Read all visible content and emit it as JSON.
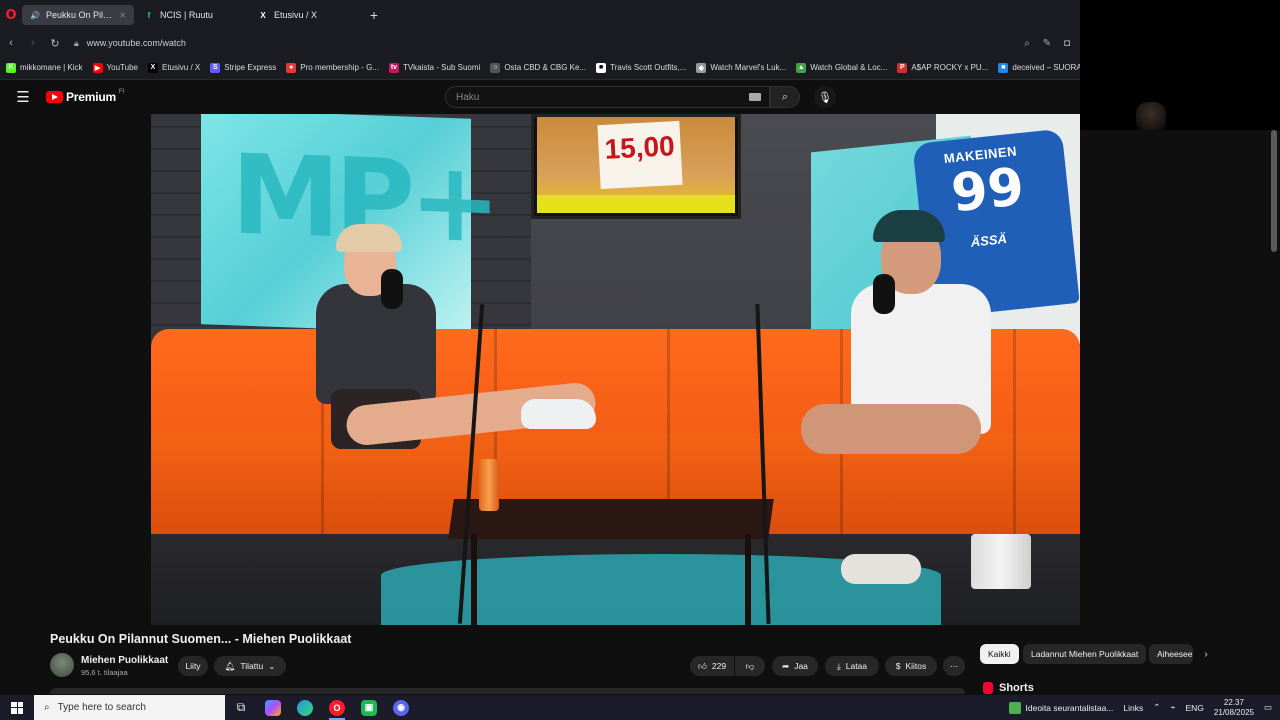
{
  "browser": {
    "tabs": [
      {
        "title": "Peukku On Pilannut S",
        "icon": "speaker-icon",
        "active": true
      },
      {
        "title": "NCIS | Ruutu",
        "icon": "ruutu-icon",
        "active": false
      },
      {
        "title": "Etusivu / X",
        "icon": "x-icon",
        "active": false
      }
    ],
    "url": "www.youtube.com/watch",
    "bookmarks": [
      {
        "label": "mikkomane | Kick",
        "icon_color": "#53fc18",
        "glyph": "K"
      },
      {
        "label": "YouTube",
        "icon_color": "#ff0000",
        "glyph": "▶"
      },
      {
        "label": "Etusivu / X",
        "icon_color": "#000000",
        "glyph": "X"
      },
      {
        "label": "Stripe Express",
        "icon_color": "#635bff",
        "glyph": "S"
      },
      {
        "label": "Pro membership - G...",
        "icon_color": "#e53935",
        "glyph": "●"
      },
      {
        "label": "TVkaista - Sub Suomi",
        "icon_color": "#c2185b",
        "glyph": "tv"
      },
      {
        "label": "Osta CBD & CBG Ke...",
        "icon_color": "#555555",
        "glyph": "○"
      },
      {
        "label": "Travis Scott Outfits,...",
        "icon_color": "#ffffff",
        "glyph": "■"
      },
      {
        "label": "Watch Marvel's Luk...",
        "icon_color": "#999999",
        "glyph": "◆"
      },
      {
        "label": "Watch Global & Loc...",
        "icon_color": "#43a047",
        "glyph": "▲"
      },
      {
        "label": "A$AP ROCKY x PU...",
        "icon_color": "#d32f2f",
        "glyph": "P"
      },
      {
        "label": "deceived – SUORAT...",
        "icon_color": "#1e88e5",
        "glyph": "■"
      }
    ]
  },
  "youtube": {
    "logo_text": "Premium",
    "logo_sup": "FI",
    "search_placeholder": "Haku"
  },
  "video": {
    "tv_sign": "15,00",
    "jersey_name": "MAKEINEN",
    "jersey_number": "99",
    "jersey_logo": "ÄSSÄ"
  },
  "watch": {
    "title": "Peukku On Pilannut Suomen... - Miehen Puolikkaat",
    "channel_name": "Miehen Puolikkaat",
    "subscribers": "95,6 t. tilaajaa",
    "join_label": "Liity",
    "subscribed_label": "Tilattu",
    "likes": "229",
    "share_label": "Jaa",
    "download_label": "Lataa",
    "thanks_label": "Kiitos",
    "chips": [
      "Kaikki",
      "Ladannut Miehen Puolikkaat",
      "Aiheeseen"
    ],
    "shorts_label": "Shorts"
  },
  "taskbar": {
    "search_placeholder": "Type here to search",
    "weather": "Ideoita seurantalistaa...",
    "links": "Links",
    "language": "ENG",
    "time": "22.37",
    "date": "21/08/2025"
  }
}
